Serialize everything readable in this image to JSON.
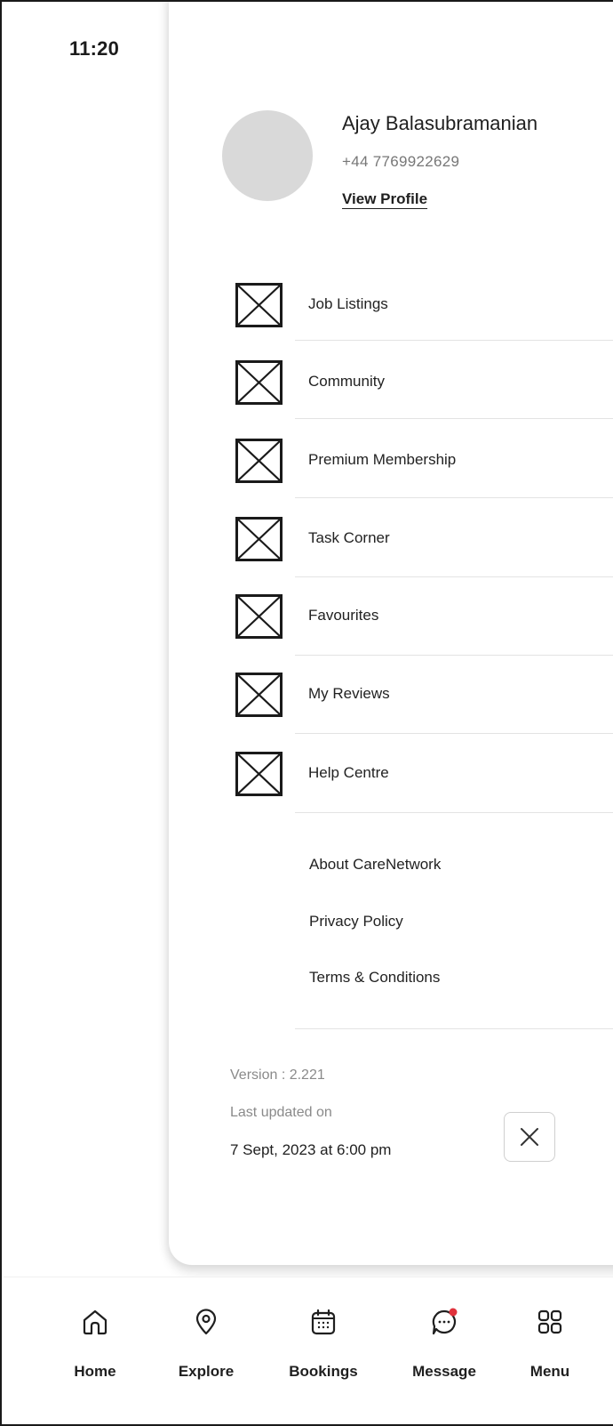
{
  "status_bar": {
    "time": "11:20",
    "icons": [
      "signal-icon",
      "wifi-icon",
      "battery-icon"
    ]
  },
  "profile": {
    "name": "Ajay Balasubramanian",
    "phone": "+44 7769922629",
    "view_profile_label": "View Profile"
  },
  "menu": {
    "items": [
      {
        "label": "Job Listings",
        "icon": "image-placeholder-icon"
      },
      {
        "label": "Community",
        "icon": "image-placeholder-icon"
      },
      {
        "label": "Premium Membership",
        "icon": "image-placeholder-icon"
      },
      {
        "label": "Task Corner",
        "icon": "image-placeholder-icon"
      },
      {
        "label": "Favourites",
        "icon": "image-placeholder-icon"
      },
      {
        "label": "My Reviews",
        "icon": "image-placeholder-icon"
      },
      {
        "label": "Help Centre",
        "icon": "image-placeholder-icon"
      }
    ],
    "links": [
      {
        "label": "About CareNetwork"
      },
      {
        "label": "Privacy Policy"
      },
      {
        "label": "Terms & Conditions"
      }
    ]
  },
  "footer_info": {
    "version_label": "Version : 2.221",
    "last_updated_label": "Last updated on",
    "last_updated_value": "7 Sept, 2023 at 6:00 pm"
  },
  "bottom_nav": {
    "items": [
      {
        "label": "Home",
        "icon": "home-icon",
        "active": false
      },
      {
        "label": "Explore",
        "icon": "location-pin-icon",
        "active": false
      },
      {
        "label": "Bookings",
        "icon": "calendar-icon",
        "active": false
      },
      {
        "label": "Message",
        "icon": "chat-bubble-icon",
        "active": false,
        "badge": true
      },
      {
        "label": "Menu",
        "icon": "grid-icon",
        "active": true
      }
    ]
  },
  "colors": {
    "accent_badge": "#e0323c",
    "avatar_placeholder": "#d9d9d9",
    "active_tab_bg": "#ededed",
    "text_primary": "#1f1f1f",
    "text_muted": "#8a8a8a"
  }
}
